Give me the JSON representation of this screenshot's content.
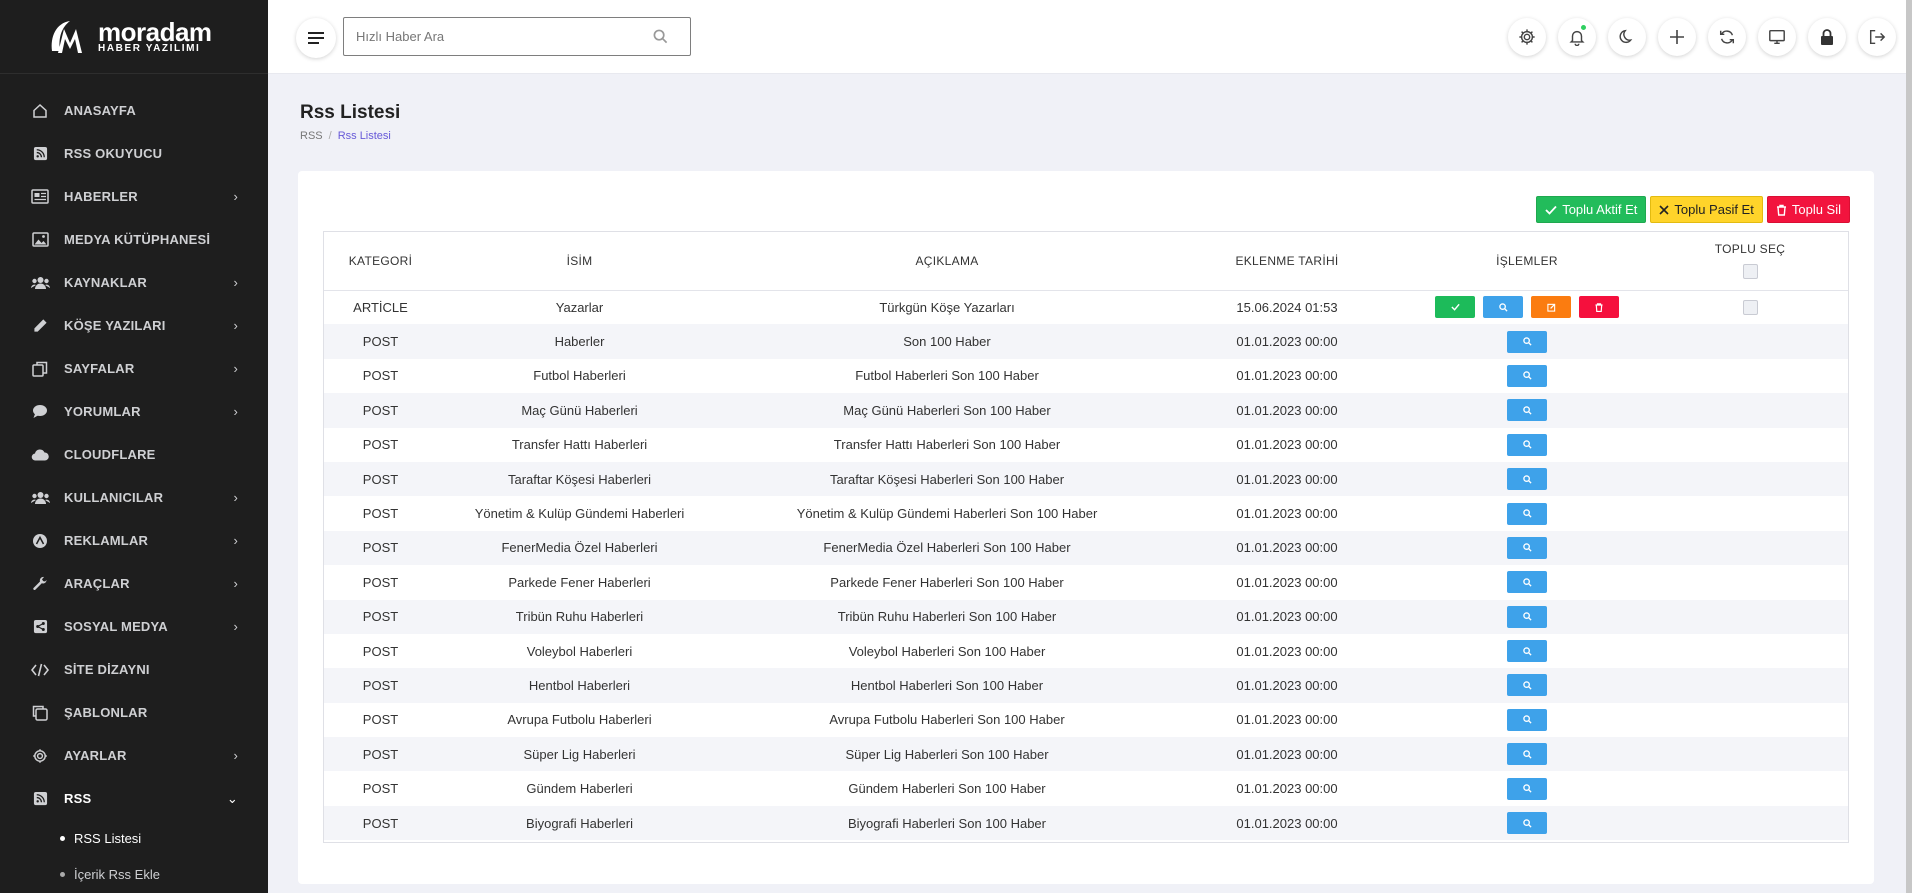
{
  "brand": {
    "name": "moradam",
    "tagline": "HABER YAZILIMI"
  },
  "search": {
    "placeholder": "Hızlı Haber Ara"
  },
  "sidebar": {
    "items": [
      {
        "label": "ANASAYFA",
        "icon": "home-icon",
        "chevron": ""
      },
      {
        "label": "RSS OKUYUCU",
        "icon": "rss-icon",
        "chevron": ""
      },
      {
        "label": "HABERLER",
        "icon": "newspaper-icon",
        "chevron": "›"
      },
      {
        "label": "MEDYA KÜTÜPHANESİ",
        "icon": "image-icon",
        "chevron": ""
      },
      {
        "label": "KAYNAKLAR",
        "icon": "users-icon",
        "chevron": "›"
      },
      {
        "label": "KÖŞE YAZILARI",
        "icon": "pencil-icon",
        "chevron": "›"
      },
      {
        "label": "SAYFALAR",
        "icon": "pages-icon",
        "chevron": "›"
      },
      {
        "label": "YORUMLAR",
        "icon": "comment-icon",
        "chevron": "›"
      },
      {
        "label": "CLOUDFLARE",
        "icon": "cloud-icon",
        "chevron": ""
      },
      {
        "label": "KULLANICILAR",
        "icon": "users-icon",
        "chevron": "›"
      },
      {
        "label": "REKLAMLAR",
        "icon": "ads-icon",
        "chevron": "›"
      },
      {
        "label": "ARAÇLAR",
        "icon": "wrench-icon",
        "chevron": "›"
      },
      {
        "label": "SOSYAL MEDYA",
        "icon": "share-icon",
        "chevron": "›"
      },
      {
        "label": "SİTE DİZAYNI",
        "icon": "code-icon",
        "chevron": ""
      },
      {
        "label": "ŞABLONLAR",
        "icon": "template-icon",
        "chevron": ""
      },
      {
        "label": "AYARLAR",
        "icon": "gear-icon",
        "chevron": "›"
      },
      {
        "label": "RSS",
        "icon": "rss-icon",
        "chevron": "⌄"
      }
    ],
    "subitems": [
      {
        "label": "RSS Listesi"
      },
      {
        "label": "İçerik Rss Ekle"
      }
    ]
  },
  "page": {
    "title": "Rss Listesi",
    "breadcrumb": [
      "RSS",
      "Rss Listesi"
    ]
  },
  "bulk_actions": {
    "activate": "Toplu Aktif Et",
    "deactivate": "Toplu Pasif Et",
    "delete": "Toplu Sil"
  },
  "table": {
    "headers": [
      "KATEGORİ",
      "İSİM",
      "AÇIKLAMA",
      "EKLENME TARİHİ",
      "İŞLEMLER",
      "TOPLU SEÇ"
    ],
    "rows": [
      {
        "kategori": "ARTİCLE",
        "isim": "Yazarlar",
        "aciklama": "Türkgün Köşe Yazarları",
        "tarih": "15.06.2024 01:53"
      },
      {
        "kategori": "POST",
        "isim": "Haberler",
        "aciklama": "Son 100 Haber",
        "tarih": "01.01.2023 00:00"
      },
      {
        "kategori": "POST",
        "isim": "Futbol Haberleri",
        "aciklama": "Futbol Haberleri Son 100 Haber",
        "tarih": "01.01.2023 00:00"
      },
      {
        "kategori": "POST",
        "isim": "Maç Günü Haberleri",
        "aciklama": "Maç Günü Haberleri Son 100 Haber",
        "tarih": "01.01.2023 00:00"
      },
      {
        "kategori": "POST",
        "isim": "Transfer Hattı Haberleri",
        "aciklama": "Transfer Hattı Haberleri Son 100 Haber",
        "tarih": "01.01.2023 00:00"
      },
      {
        "kategori": "POST",
        "isim": "Taraftar Köşesi Haberleri",
        "aciklama": "Taraftar Köşesi Haberleri Son 100 Haber",
        "tarih": "01.01.2023 00:00"
      },
      {
        "kategori": "POST",
        "isim": "Yönetim & Kulüp Gündemi Haberleri",
        "aciklama": "Yönetim & Kulüp Gündemi Haberleri Son 100 Haber",
        "tarih": "01.01.2023 00:00"
      },
      {
        "kategori": "POST",
        "isim": "FenerMedia Özel Haberleri",
        "aciklama": "FenerMedia Özel Haberleri Son 100 Haber",
        "tarih": "01.01.2023 00:00"
      },
      {
        "kategori": "POST",
        "isim": "Parkede Fener Haberleri",
        "aciklama": "Parkede Fener Haberleri Son 100 Haber",
        "tarih": "01.01.2023 00:00"
      },
      {
        "kategori": "POST",
        "isim": "Tribün Ruhu Haberleri",
        "aciklama": "Tribün Ruhu Haberleri Son 100 Haber",
        "tarih": "01.01.2023 00:00"
      },
      {
        "kategori": "POST",
        "isim": "Voleybol Haberleri",
        "aciklama": "Voleybol Haberleri Son 100 Haber",
        "tarih": "01.01.2023 00:00"
      },
      {
        "kategori": "POST",
        "isim": "Hentbol Haberleri",
        "aciklama": "Hentbol Haberleri Son 100 Haber",
        "tarih": "01.01.2023 00:00"
      },
      {
        "kategori": "POST",
        "isim": "Avrupa Futbolu Haberleri",
        "aciklama": "Avrupa Futbolu Haberleri Son 100 Haber",
        "tarih": "01.01.2023 00:00"
      },
      {
        "kategori": "POST",
        "isim": "Süper Lig Haberleri",
        "aciklama": "Süper Lig Haberleri Son 100 Haber",
        "tarih": "01.01.2023 00:00"
      },
      {
        "kategori": "POST",
        "isim": "Gündem Haberleri",
        "aciklama": "Gündem Haberleri Son 100 Haber",
        "tarih": "01.01.2023 00:00"
      },
      {
        "kategori": "POST",
        "isim": "Biyografi Haberleri",
        "aciklama": "Biyografi Haberleri Son 100 Haber",
        "tarih": "01.01.2023 00:00"
      }
    ]
  },
  "colors": {
    "sidebar_bg": "#1e1e1e",
    "accent": "#6759d8",
    "green": "#22bc5b",
    "yellow": "#ffd42a",
    "red": "#f2143e",
    "blue": "#3ea2ea",
    "orange": "#fb7c10"
  }
}
